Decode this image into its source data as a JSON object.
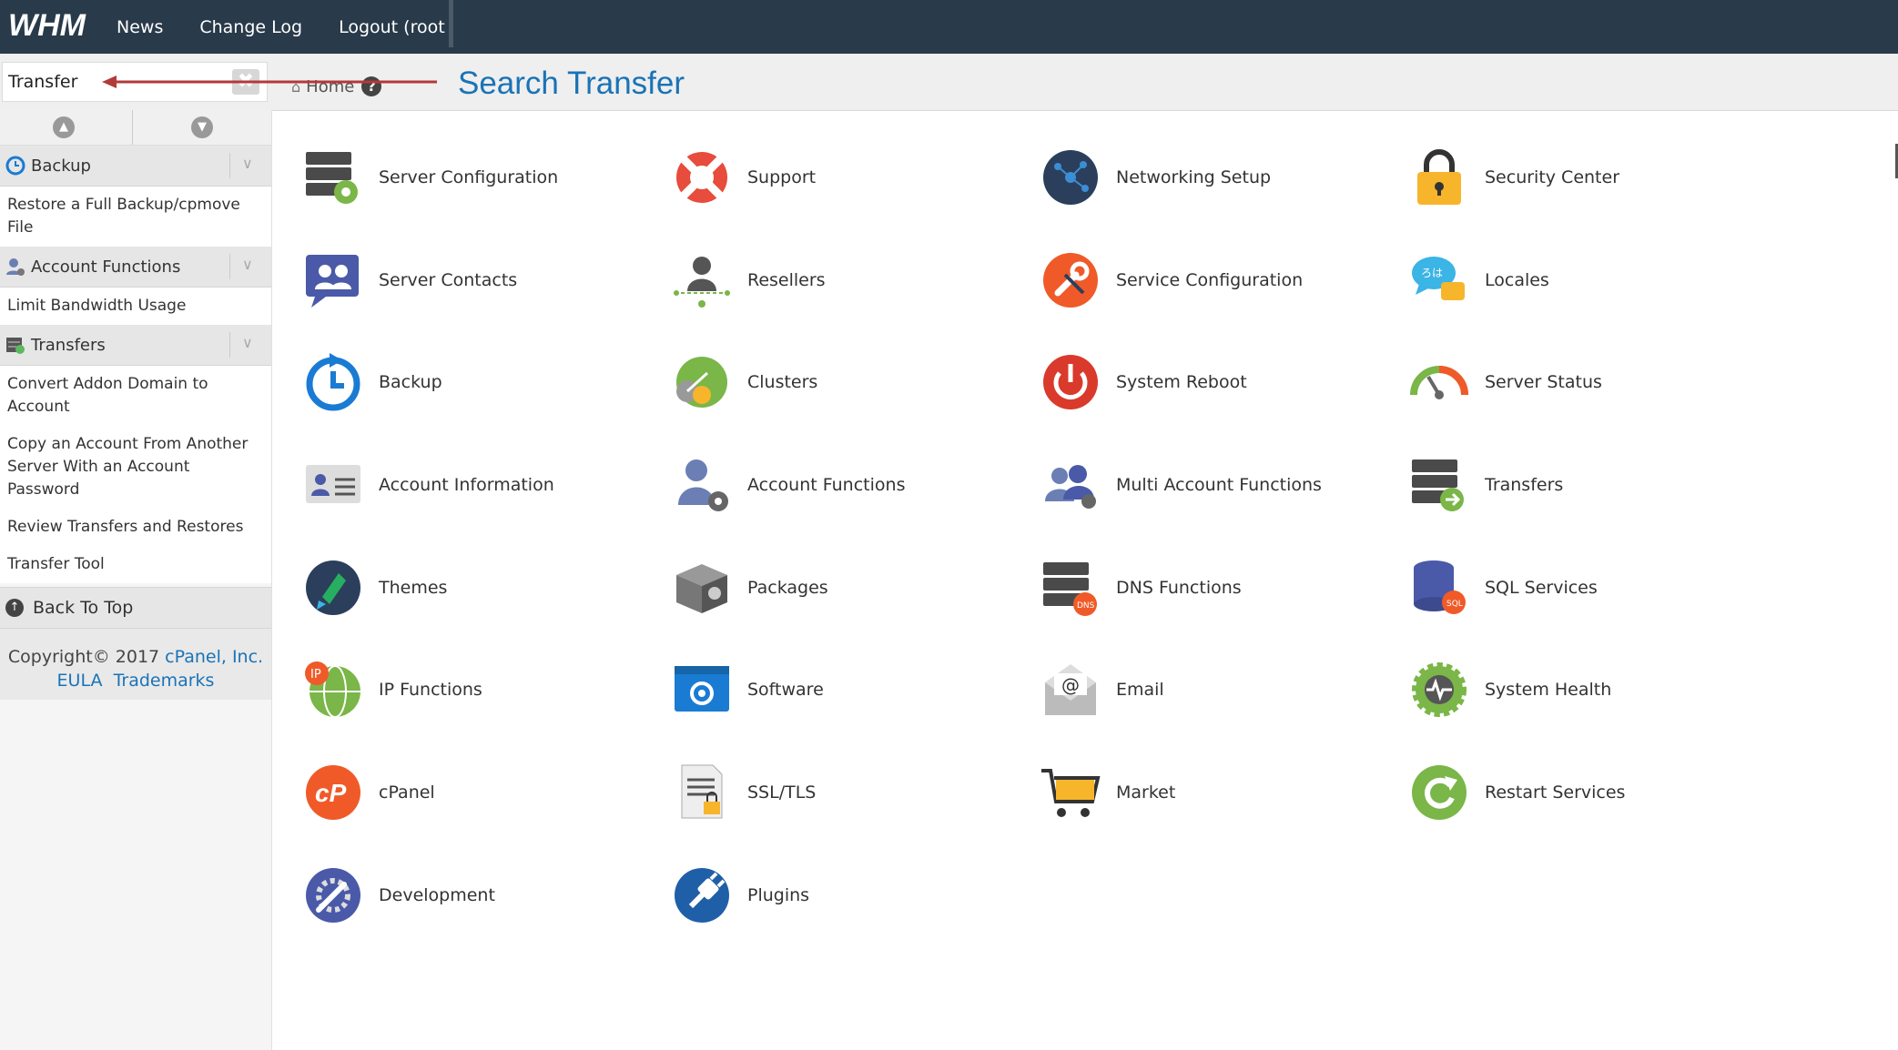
{
  "topbar": {
    "logo_text": "WHM",
    "nav": [
      "News",
      "Change Log",
      "Logout (root"
    ]
  },
  "search": {
    "value": "Transfer",
    "placeholder": ""
  },
  "breadcrumb": {
    "home": "Home",
    "help": "?"
  },
  "annotation": "Search Transfer",
  "sidebar": {
    "sections": [
      {
        "title": "Backup",
        "links": [
          "Restore a Full Backup/cpmove File"
        ]
      },
      {
        "title": "Account Functions",
        "links": [
          "Limit Bandwidth Usage"
        ]
      },
      {
        "title": "Transfers",
        "links": [
          "Convert Addon Domain to Account",
          "Copy an Account From Another Server With an Account Password",
          "Review Transfers and Restores",
          "Transfer Tool"
        ]
      }
    ],
    "back_to_top": "Back To Top",
    "copyright": "Copyright© 2017",
    "company": "cPanel, Inc.",
    "eula": "EULA",
    "trademarks": "Trademarks"
  },
  "colors": {
    "topbar": "#293a4a",
    "accent": "#1a73b6"
  },
  "grid": {
    "rows": [
      [
        {
          "label": "Server Configuration",
          "icon": "server-config-icon"
        },
        {
          "label": "Support",
          "icon": "lifebuoy-icon"
        },
        {
          "label": "Networking Setup",
          "icon": "network-globe-icon"
        },
        {
          "label": "Security Center",
          "icon": "padlock-icon"
        }
      ],
      [
        {
          "label": "Server Contacts",
          "icon": "contacts-icon"
        },
        {
          "label": "Resellers",
          "icon": "reseller-icon"
        },
        {
          "label": "Service Configuration",
          "icon": "wrench-icon"
        },
        {
          "label": "Locales",
          "icon": "locales-icon"
        }
      ],
      [
        {
          "label": "Backup",
          "icon": "backup-clock-icon"
        },
        {
          "label": "Clusters",
          "icon": "clusters-icon"
        },
        {
          "label": "System Reboot",
          "icon": "power-icon"
        },
        {
          "label": "Server Status",
          "icon": "gauge-icon"
        }
      ],
      [
        {
          "label": "Account Information",
          "icon": "id-card-icon"
        },
        {
          "label": "Account Functions",
          "icon": "user-gear-icon"
        },
        {
          "label": "Multi Account Functions",
          "icon": "multi-user-icon"
        },
        {
          "label": "Transfers",
          "icon": "server-transfer-icon"
        }
      ],
      [
        {
          "label": "Themes",
          "icon": "themes-icon"
        },
        {
          "label": "Packages",
          "icon": "package-icon"
        },
        {
          "label": "DNS Functions",
          "icon": "dns-icon"
        },
        {
          "label": "SQL Services",
          "icon": "database-icon"
        }
      ],
      [
        {
          "label": "IP Functions",
          "icon": "ip-globe-icon"
        },
        {
          "label": "Software",
          "icon": "software-window-icon"
        },
        {
          "label": "Email",
          "icon": "email-icon"
        },
        {
          "label": "System Health",
          "icon": "health-gear-icon"
        }
      ],
      [
        {
          "label": "cPanel",
          "icon": "cpanel-logo-icon"
        },
        {
          "label": "SSL/TLS",
          "icon": "ssl-doc-icon"
        },
        {
          "label": "Market",
          "icon": "cart-icon"
        },
        {
          "label": "Restart Services",
          "icon": "restart-icon"
        }
      ],
      [
        {
          "label": "Development",
          "icon": "development-icon"
        },
        {
          "label": "Plugins",
          "icon": "plug-icon"
        }
      ]
    ]
  }
}
